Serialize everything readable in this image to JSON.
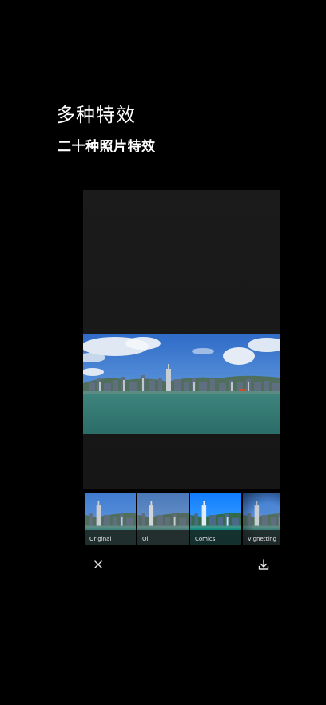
{
  "promo": {
    "headline": "多种特效",
    "subheadline": "二十种照片特效"
  },
  "editor": {
    "photo_subject": "harbor-skyline-photo"
  },
  "filters": [
    {
      "label": "Original",
      "style": "original"
    },
    {
      "label": "Oil",
      "style": "oil"
    },
    {
      "label": "Comics",
      "style": "comics"
    },
    {
      "label": "Vignetting",
      "style": "vignetting"
    }
  ],
  "toolbar": {
    "close_icon": "close-icon",
    "save_icon": "download-icon"
  }
}
